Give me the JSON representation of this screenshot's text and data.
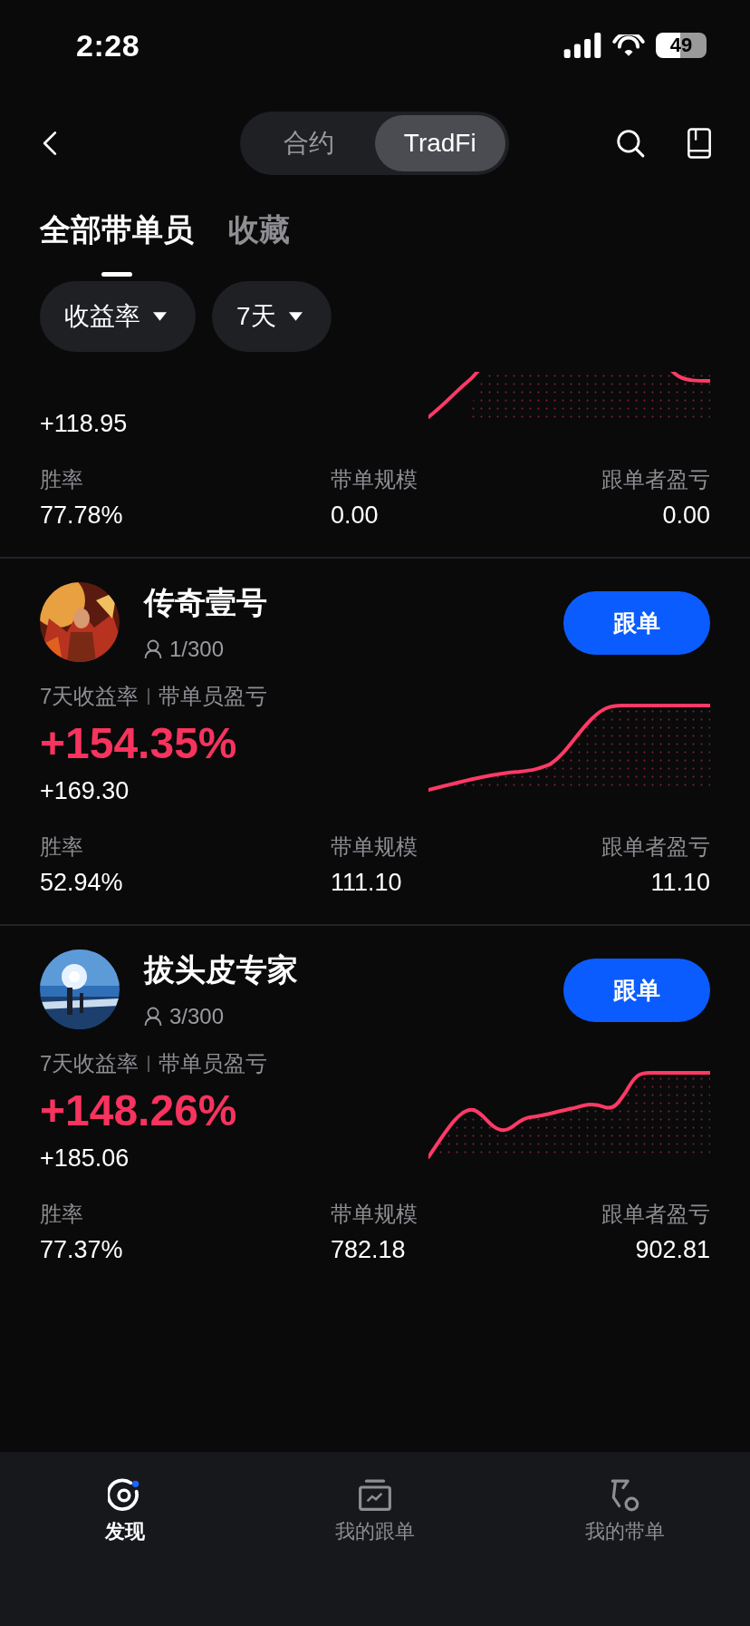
{
  "status_bar": {
    "time": "2:28",
    "battery": "49"
  },
  "header": {
    "segments": [
      {
        "label": "合约",
        "selected": false
      },
      {
        "label": "TradFi",
        "selected": true
      }
    ]
  },
  "tabs": [
    {
      "label": "全部带单员",
      "selected": true
    },
    {
      "label": "收藏",
      "selected": false
    }
  ],
  "filters": [
    {
      "label": "收益率"
    },
    {
      "label": "7天"
    }
  ],
  "traders": [
    {
      "pnl": "+118.95",
      "stats": [
        {
          "label": "胜率",
          "value": "77.78%"
        },
        {
          "label": "带单规模",
          "value": "0.00"
        },
        {
          "label": "跟单者盈亏",
          "value": "0.00"
        }
      ]
    },
    {
      "name": "传奇壹号",
      "followers": "1/300",
      "follow_button": "跟单",
      "metric_label": "7天收益率",
      "pnl_label": "带单员盈亏",
      "roi": "+154.35%",
      "pnl": "+169.30",
      "stats": [
        {
          "label": "胜率",
          "value": "52.94%"
        },
        {
          "label": "带单规模",
          "value": "111.10"
        },
        {
          "label": "跟单者盈亏",
          "value": "11.10"
        }
      ]
    },
    {
      "name": "拔头皮专家",
      "followers": "3/300",
      "follow_button": "跟单",
      "metric_label": "7天收益率",
      "pnl_label": "带单员盈亏",
      "roi": "+148.26%",
      "pnl": "+185.06",
      "stats": [
        {
          "label": "胜率",
          "value": "77.37%"
        },
        {
          "label": "带单规模",
          "value": "782.18"
        },
        {
          "label": "跟单者盈亏",
          "value": "902.81"
        }
      ]
    }
  ],
  "bottom_nav": [
    {
      "label": "发现",
      "kind": "discover",
      "selected": true
    },
    {
      "label": "我的跟单",
      "kind": "copy",
      "selected": false
    },
    {
      "label": "我的带单",
      "kind": "lead",
      "selected": false
    }
  ]
}
